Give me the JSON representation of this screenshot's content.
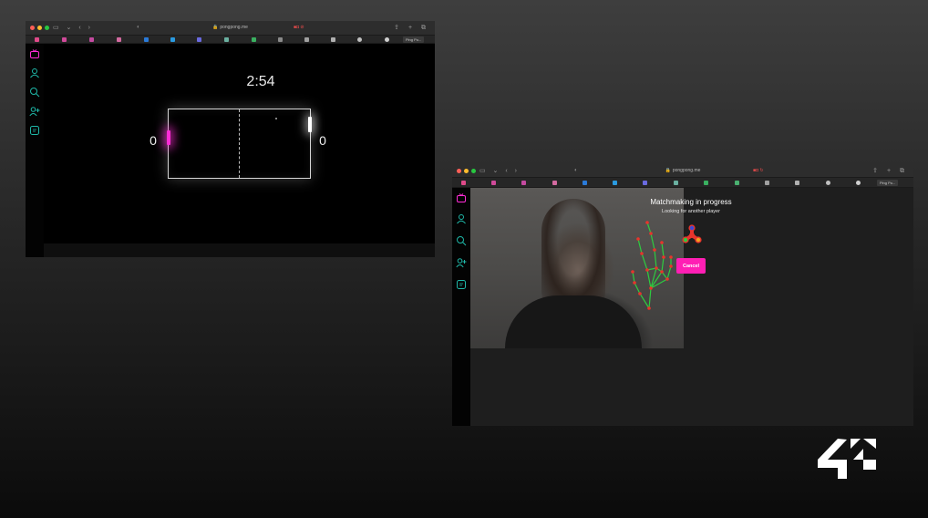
{
  "game_window": {
    "url": "pongpong.me",
    "tab_label": "Ping Po...",
    "timer": "2:54",
    "score_left": "0",
    "score_right": "0",
    "left_paddle_color": "#ff2bd6",
    "right_paddle_color": "#ffffff"
  },
  "matchmaking_window": {
    "url": "pongpong.me",
    "tab_label": "Ping Po...",
    "title": "Matchmaking in progress",
    "subtitle": "Looking for another player",
    "cancel_label": "Cancel",
    "accent": "#ff1fb4"
  },
  "sidebar_icons": [
    "tv-icon",
    "user-icon",
    "search-icon",
    "add-user-icon",
    "chat-icon"
  ],
  "sidebar_color": "#1fb8a8",
  "logo": "42"
}
